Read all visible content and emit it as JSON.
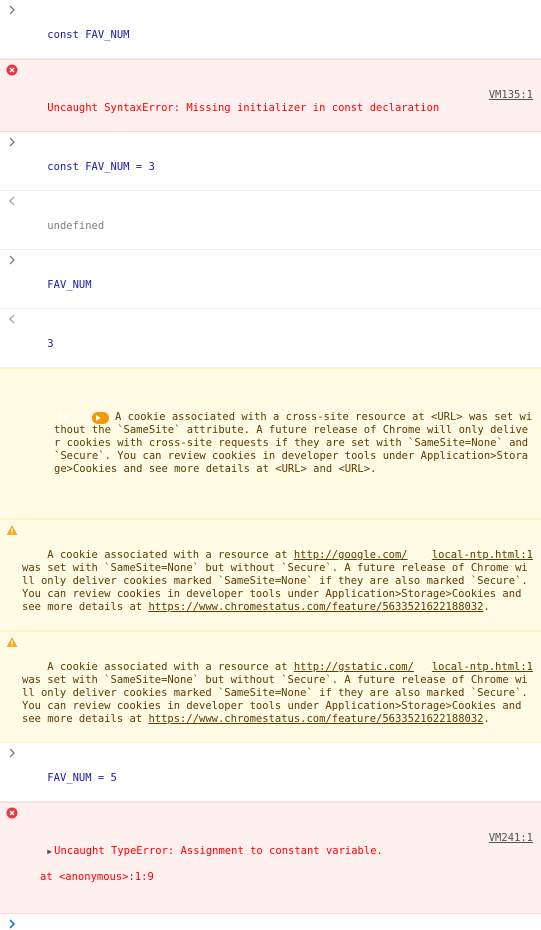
{
  "colors": {
    "error_text": "#ff0000",
    "error_bg": "#fff0f0",
    "warning_text": "#5c3c00",
    "warning_bg": "#fffbe5",
    "badge_bg": "#f29900",
    "input_text": "#1a1aa6"
  },
  "entries": [
    {
      "kind": "input",
      "text": "const FAV_NUM"
    },
    {
      "kind": "error",
      "text": "Uncaught SyntaxError: Missing initializer in const declaration",
      "source": "VM135:1"
    },
    {
      "kind": "input",
      "text": "const FAV_NUM = 3"
    },
    {
      "kind": "result",
      "text": "undefined"
    },
    {
      "kind": "input",
      "text": "FAV_NUM"
    },
    {
      "kind": "result",
      "text": "3"
    },
    {
      "kind": "warning-group",
      "count": "14",
      "text": "A cookie associated with a cross-site resource at <URL> was set without the `SameSite` attribute. A future release of Chrome will only deliver cookies with cross-site requests if they are set with `SameSite=None` and `Secure`. You can review cookies in developer tools under Application>Storage>Cookies and see more details at <URL> and <URL>."
    },
    {
      "kind": "warning",
      "text_before": "A cookie associated with a resource at ",
      "link1": "http://google.com/",
      "text_after": " was set with `SameSite=None` but without `Secure`. A future release of Chrome will only deliver cookies marked `SameSite=None` if they are also marked `Secure`. You can review cookies in developer tools under Application>Storage>Cookies and see more details at ",
      "link2": "https://www.chromestatus.com/feature/5633521622188032",
      "text_end": ".",
      "source": "local-ntp.html:1"
    },
    {
      "kind": "warning",
      "text_before": "A cookie associated with a resource at ",
      "link1": "http://gstatic.com/",
      "text_after": " was set with `SameSite=None` but without `Secure`. A future release of Chrome will only deliver cookies marked `SameSite=None` if they are also marked `Secure`. You can review cookies in developer tools under Application>Storage>Cookies and see more details at ",
      "link2": "https://www.chromestatus.com/feature/5633521622188032",
      "text_end": ".",
      "source": "local-ntp.html:1"
    },
    {
      "kind": "input",
      "text": "FAV_NUM = 5"
    },
    {
      "kind": "error",
      "text": "Uncaught TypeError: Assignment to constant variable.",
      "line2": "at <anonymous>:1:9",
      "source": "VM241:1"
    }
  ],
  "prompt": {
    "value": ""
  }
}
